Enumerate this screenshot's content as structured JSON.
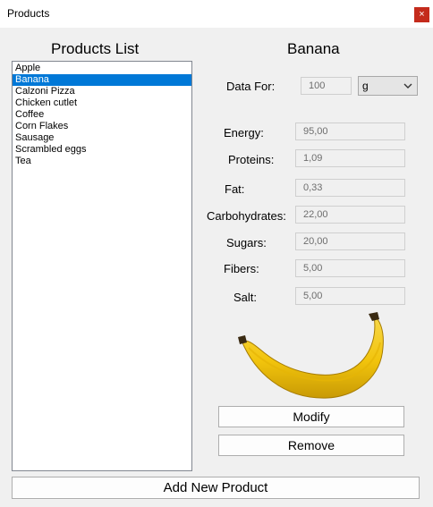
{
  "window": {
    "title": "Products",
    "close_glyph": "×"
  },
  "list": {
    "heading": "Products List",
    "items": [
      "Apple",
      "Banana",
      "Calzoni Pizza",
      "Chicken cutlet",
      "Coffee",
      "Corn Flakes",
      "Sausage",
      "Scrambled eggs",
      "Tea"
    ],
    "selected_index": 1
  },
  "detail": {
    "product_name": "Banana",
    "data_for_label": "Data For:",
    "amount": "100",
    "unit": "g",
    "nutrients": {
      "energy": {
        "label": "Energy:",
        "value": "95,00"
      },
      "proteins": {
        "label": "Proteins:",
        "value": "1,09"
      },
      "fat": {
        "label": "Fat:",
        "value": "0,33"
      },
      "carbohydrates": {
        "label": "Carbohydrates:",
        "value": "22,00"
      },
      "sugars": {
        "label": "Sugars:",
        "value": "20,00"
      },
      "fibers": {
        "label": "Fibers:",
        "value": "5,00"
      },
      "salt": {
        "label": "Salt:",
        "value": "5,00"
      }
    },
    "image_icon": "banana-image"
  },
  "buttons": {
    "modify": "Modify",
    "remove": "Remove",
    "add_new": "Add New Product"
  },
  "colors": {
    "selection": "#0078d7",
    "close": "#c42b1c",
    "banana": "#f2c40c"
  }
}
